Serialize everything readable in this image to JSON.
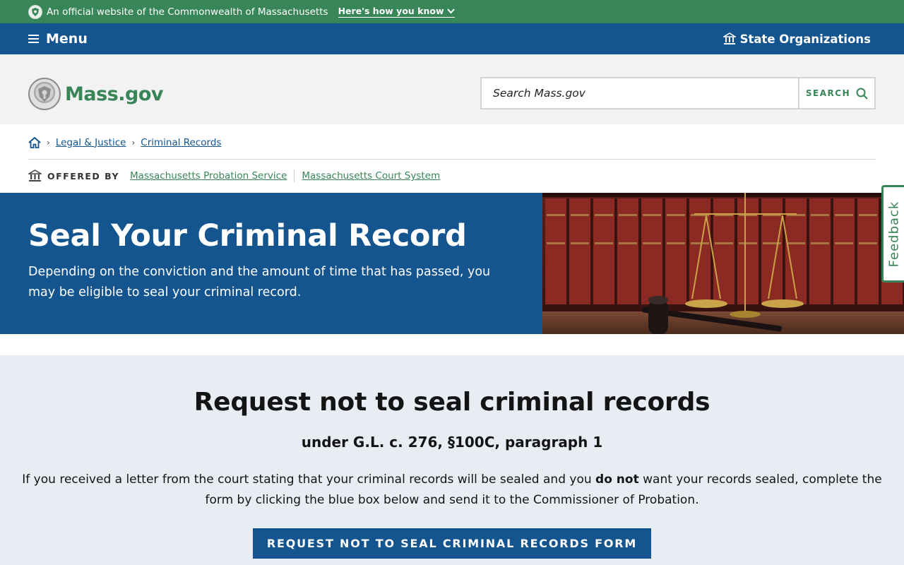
{
  "official_banner": {
    "text": "An official website of the Commonwealth of Massachusetts",
    "link": "Here's how you know"
  },
  "navbar": {
    "menu_label": "Menu",
    "state_orgs_label": "State Organizations"
  },
  "header": {
    "logo_text": "Mass.gov",
    "search_placeholder": "Search Mass.gov",
    "search_button": "SEARCH"
  },
  "breadcrumb": {
    "items": [
      "Legal & Justice",
      "Criminal Records"
    ]
  },
  "offered_by": {
    "label": "OFFERED BY",
    "orgs": [
      "Massachusetts Probation Service",
      "Massachusetts Court System"
    ]
  },
  "hero": {
    "title": "Seal Your Criminal Record",
    "description": "Depending on the conviction and the amount of time that has passed, you may be eligible to seal your criminal record."
  },
  "feedback_label": "Feedback",
  "main": {
    "title": "Request not to seal criminal records",
    "subtitle": "under G.L. c. 276, §100C, paragraph 1",
    "desc_before": "If you received a letter from the court stating that your criminal records will be sealed and you ",
    "desc_bold": "do not",
    "desc_after": " want your records sealed, complete the form by clicking the blue box below and send it to the Commissioner of Probation.",
    "cta": "REQUEST NOT TO SEAL CRIMINAL RECORDS FORM"
  },
  "colors": {
    "green": "#388557",
    "blue": "#14558f",
    "light_bg": "#e8edf4"
  }
}
